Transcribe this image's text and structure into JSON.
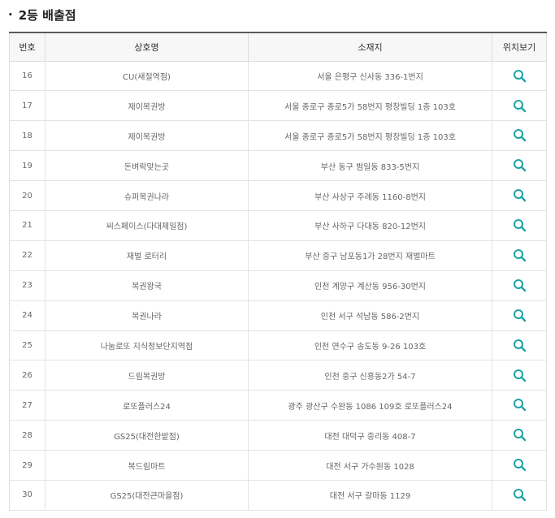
{
  "section": {
    "title": "2등 배출점"
  },
  "table": {
    "headers": [
      "번호",
      "상호명",
      "소재지",
      "위치보기"
    ],
    "rows": [
      {
        "no": "16",
        "name": "CU(새절역점)",
        "address": "서울 은평구 신사동 336-1번지"
      },
      {
        "no": "17",
        "name": "제이복권방",
        "address": "서울 종로구 종로5가 58번지 평창빌딩 1층 103호"
      },
      {
        "no": "18",
        "name": "제이복권방",
        "address": "서울 종로구 종로5가 58번지 평창빌딩 1층 103호"
      },
      {
        "no": "19",
        "name": "돈벼락맞는곳",
        "address": "부산 동구 범일동 833-5번지"
      },
      {
        "no": "20",
        "name": "슈퍼복권나라",
        "address": "부산 사상구 주례동 1160-8번지"
      },
      {
        "no": "21",
        "name": "씨스페이스(다대제일점)",
        "address": "부산 사하구 다대동 820-12번지"
      },
      {
        "no": "22",
        "name": "재벌 로터리",
        "address": "부산 중구 남포동1가 28번지 재벌마트"
      },
      {
        "no": "23",
        "name": "복권왕국",
        "address": "인천 계양구 계산동 956-30번지"
      },
      {
        "no": "24",
        "name": "복권나라",
        "address": "인천 서구 석남동 586-2번지"
      },
      {
        "no": "25",
        "name": "나눔로또 지식정보단지역점",
        "address": "인천 연수구 송도동 9-26 103호"
      },
      {
        "no": "26",
        "name": "드림복권방",
        "address": "인천 중구 신흥동2가 54-7"
      },
      {
        "no": "27",
        "name": "로또플러스24",
        "address": "광주 광산구 수완동 1086 109호 로또플러스24"
      },
      {
        "no": "28",
        "name": "GS25(대전한밭점)",
        "address": "대전 대덕구 중리동 408-7"
      },
      {
        "no": "29",
        "name": "복드림마트",
        "address": "대전 서구 가수원동 1028"
      },
      {
        "no": "30",
        "name": "GS25(대전큰마을점)",
        "address": "대전 서구 갈마동 1129"
      }
    ],
    "map_icon": "search-icon",
    "icon_color": "#1aa3a3"
  }
}
